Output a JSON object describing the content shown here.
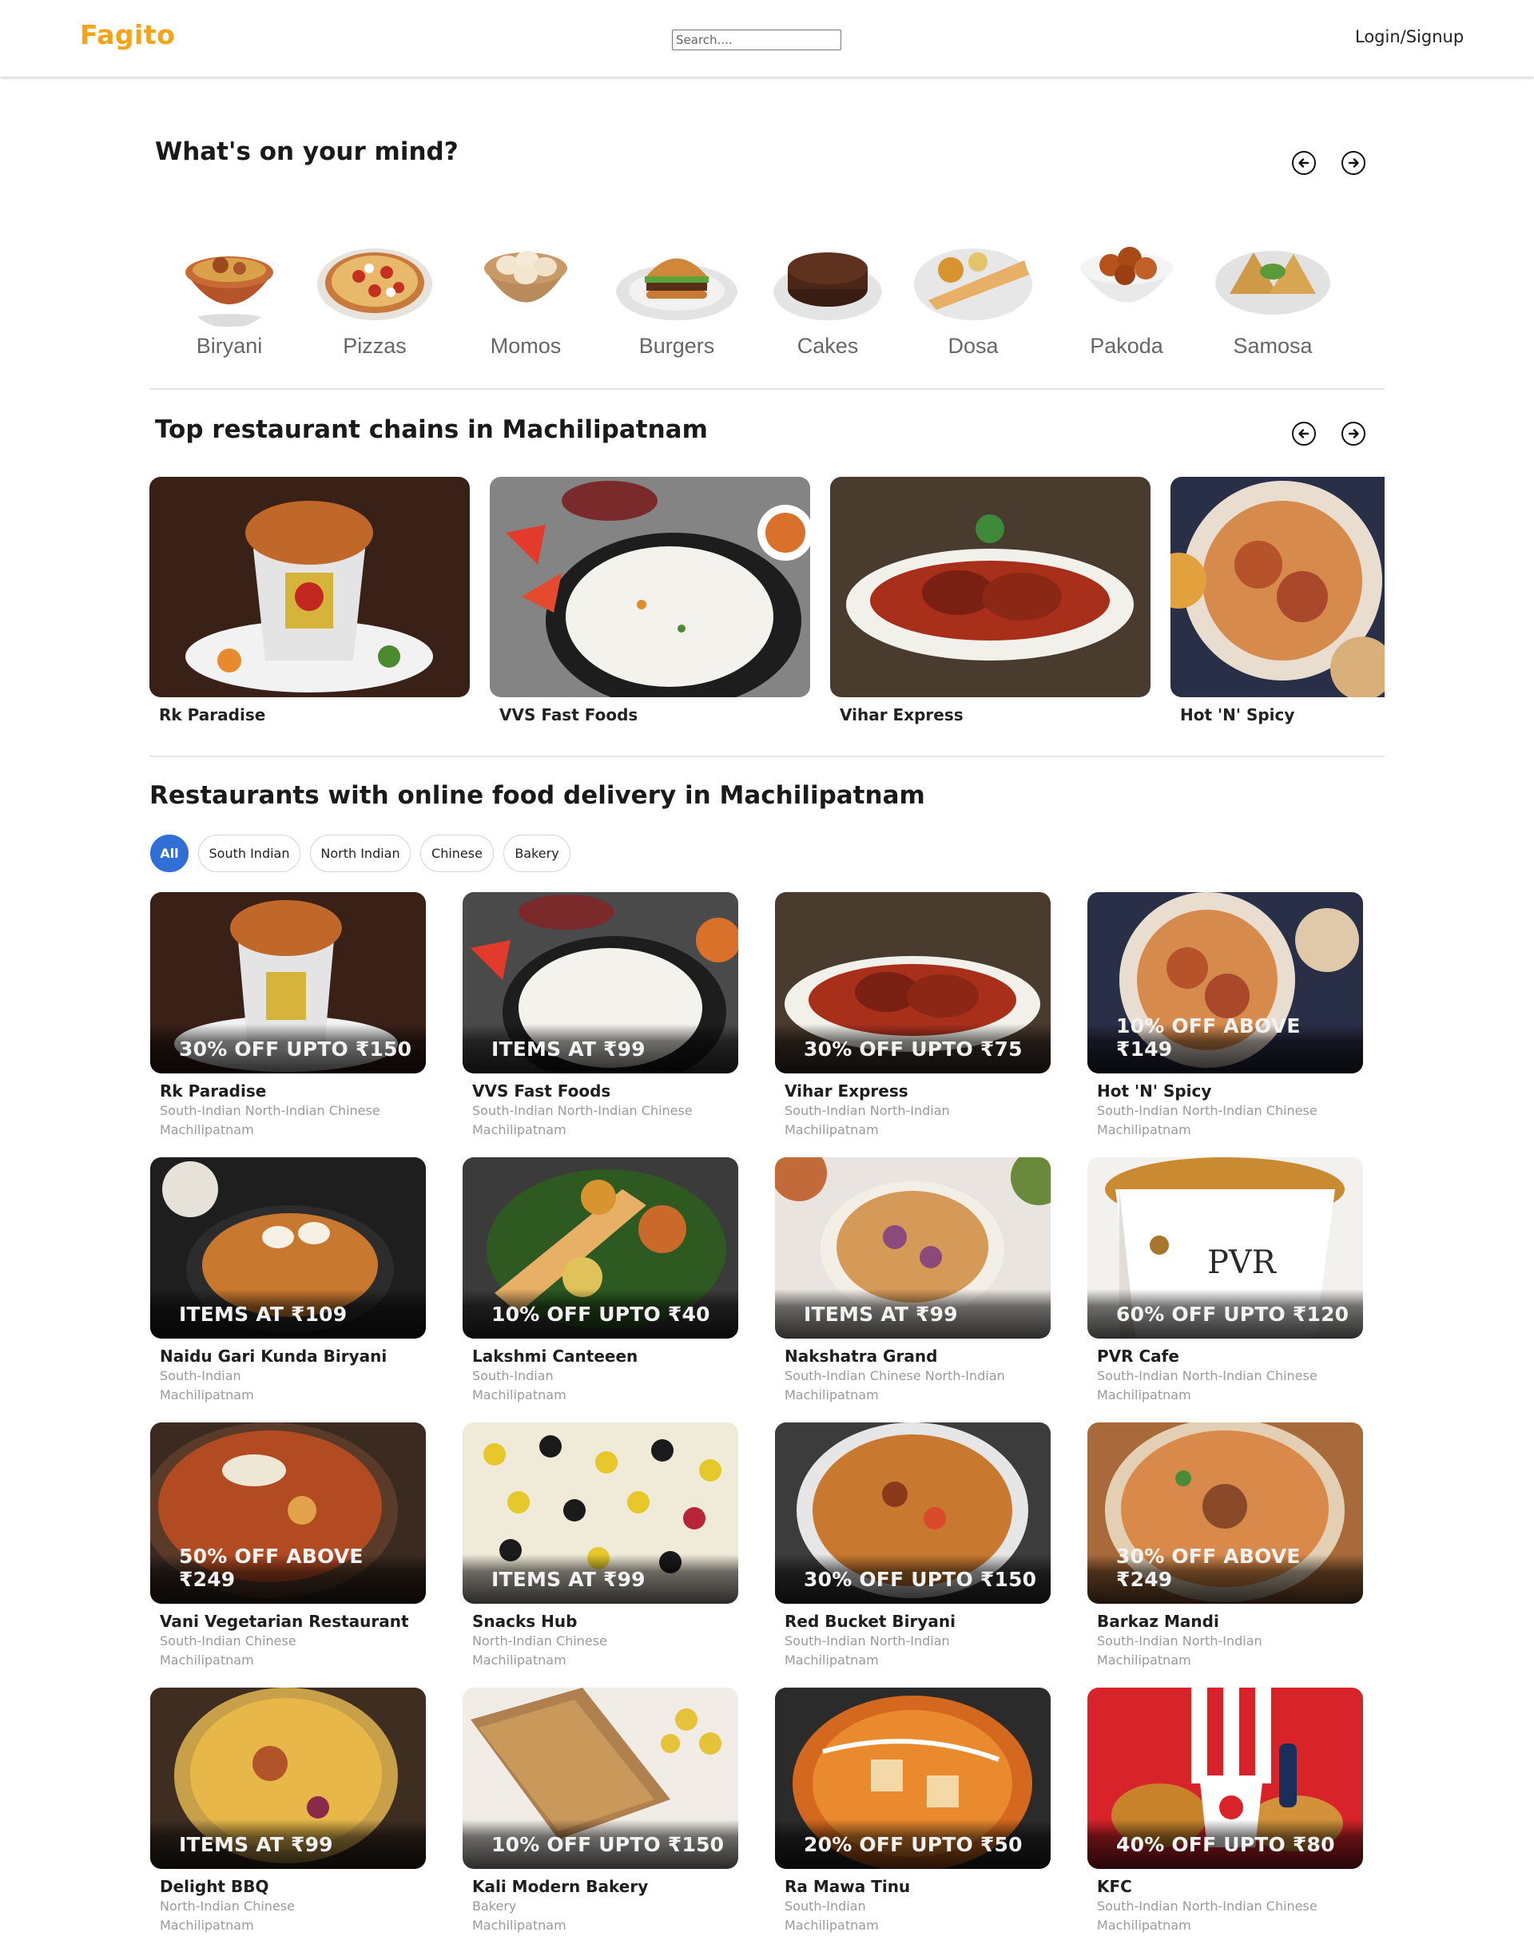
{
  "header": {
    "logo": "Fagito",
    "search_placeholder": "Search....",
    "login": "Login/Signup"
  },
  "mind": {
    "title": "What's on your mind?",
    "categories": [
      {
        "label": "Biryani"
      },
      {
        "label": "Pizzas"
      },
      {
        "label": "Momos"
      },
      {
        "label": "Burgers"
      },
      {
        "label": "Cakes"
      },
      {
        "label": "Dosa"
      },
      {
        "label": "Pakoda"
      },
      {
        "label": "Samosa"
      }
    ]
  },
  "chains": {
    "title": "Top restaurant chains in Machilipatnam",
    "items": [
      {
        "name": "Rk Paradise"
      },
      {
        "name": "VVS Fast Foods"
      },
      {
        "name": "Vihar Express"
      },
      {
        "name": "Hot 'N' Spicy"
      }
    ]
  },
  "online": {
    "title": "Restaurants with online food delivery in Machilipatnam",
    "filters": [
      "All",
      "South Indian",
      "North Indian",
      "Chinese",
      "Bakery"
    ],
    "restaurants": [
      {
        "offer": "30% OFF UPTO ₹150",
        "name": "Rk Paradise",
        "cuisine": "South-Indian North-Indian Chinese",
        "location": "Machilipatnam"
      },
      {
        "offer": "ITEMS AT ₹99",
        "name": "VVS Fast Foods",
        "cuisine": "South-Indian North-Indian Chinese",
        "location": "Machilipatnam"
      },
      {
        "offer": "30% OFF UPTO ₹75",
        "name": "Vihar Express",
        "cuisine": "South-Indian North-Indian",
        "location": "Machilipatnam"
      },
      {
        "offer": "10% OFF ABOVE ₹149",
        "name": "Hot 'N' Spicy",
        "cuisine": "South-Indian North-Indian Chinese",
        "location": "Machilipatnam"
      },
      {
        "offer": "ITEMS AT ₹109",
        "name": "Naidu Gari Kunda Biryani",
        "cuisine": "South-Indian",
        "location": "Machilipatnam"
      },
      {
        "offer": "10% OFF UPTO ₹40",
        "name": "Lakshmi Canteeen",
        "cuisine": "South-Indian",
        "location": "Machilipatnam"
      },
      {
        "offer": "ITEMS AT ₹99",
        "name": "Nakshatra Grand",
        "cuisine": "South-Indian Chinese North-Indian",
        "location": "Machilipatnam"
      },
      {
        "offer": "60% OFF UPTO ₹120",
        "name": "PVR Cafe",
        "cuisine": "South-Indian North-Indian Chinese",
        "location": "Machilipatnam"
      },
      {
        "offer": "50% OFF ABOVE ₹249",
        "name": "Vani Vegetarian Restaurant",
        "cuisine": "South-Indian Chinese",
        "location": "Machilipatnam"
      },
      {
        "offer": "ITEMS AT ₹99",
        "name": "Snacks Hub",
        "cuisine": "North-Indian Chinese",
        "location": "Machilipatnam"
      },
      {
        "offer": "30% OFF UPTO ₹150",
        "name": "Red Bucket Biryani",
        "cuisine": "South-Indian North-Indian",
        "location": "Machilipatnam"
      },
      {
        "offer": "30% OFF ABOVE ₹249",
        "name": "Barkaz Mandi",
        "cuisine": "South-Indian North-Indian",
        "location": "Machilipatnam"
      },
      {
        "offer": "ITEMS AT ₹99",
        "name": "Delight BBQ",
        "cuisine": "North-Indian Chinese",
        "location": "Machilipatnam"
      },
      {
        "offer": "10% OFF UPTO ₹150",
        "name": "Kali Modern Bakery",
        "cuisine": "Bakery",
        "location": "Machilipatnam"
      },
      {
        "offer": "20% OFF UPTO ₹50",
        "name": "Ra Mawa Tinu",
        "cuisine": "South-Indian",
        "location": "Machilipatnam"
      },
      {
        "offer": "40% OFF UPTO ₹80",
        "name": "KFC",
        "cuisine": "South-Indian North-Indian Chinese",
        "location": "Machilipatnam"
      }
    ]
  },
  "colors": {
    "brand": "#f5a417",
    "active_chip": "#2f6fd6"
  },
  "icons": [
    "arrow-left-icon",
    "arrow-right-icon"
  ]
}
